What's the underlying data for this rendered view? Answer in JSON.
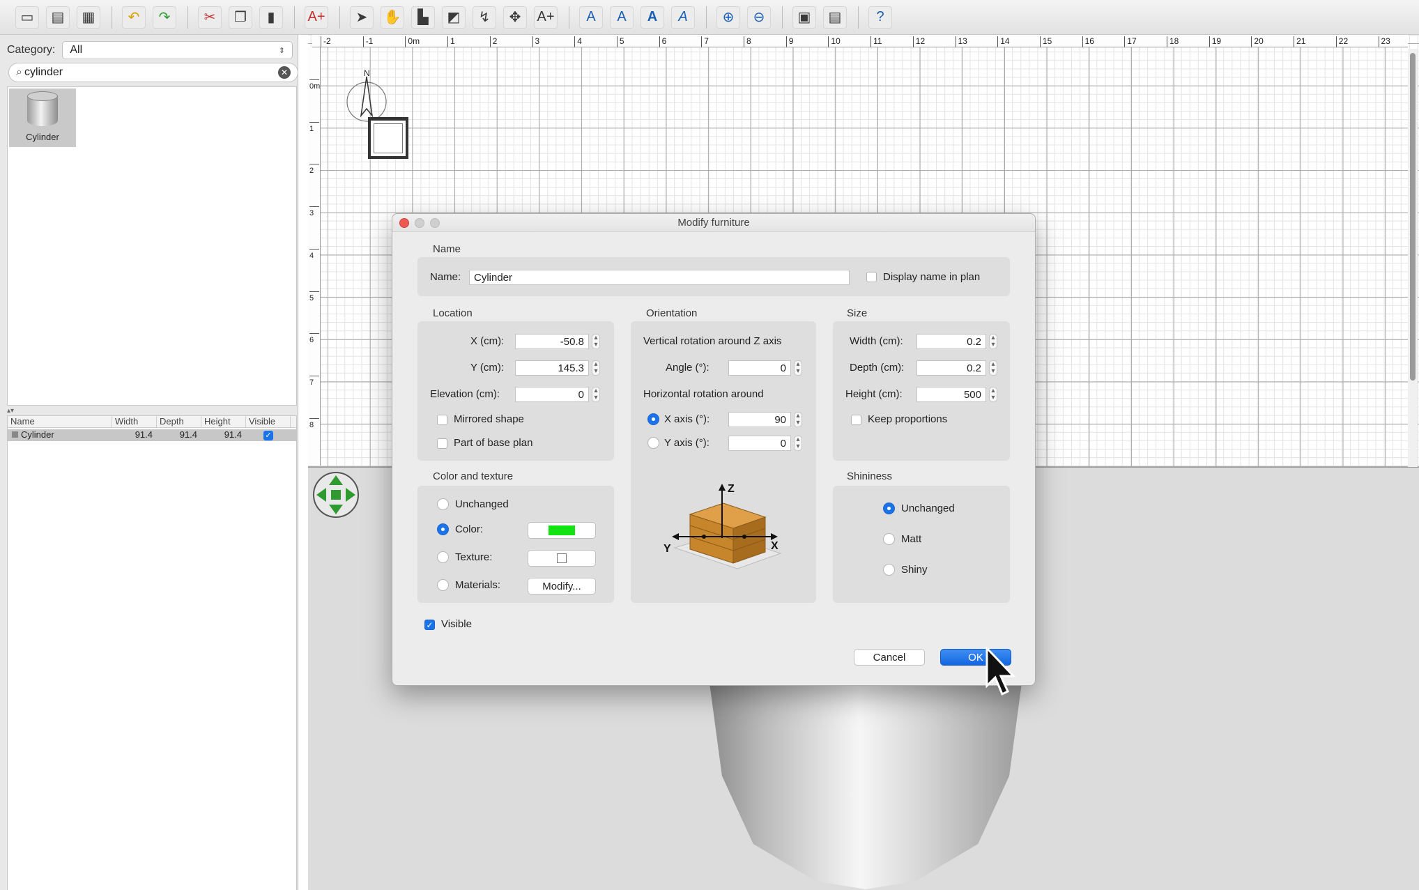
{
  "toolbar": {
    "icons": [
      "new-home-icon",
      "open-icon",
      "save-icon",
      "undo-icon",
      "redo-icon",
      "cut-icon",
      "copy-icon",
      "paste-icon",
      "add-furniture-icon",
      "select-icon",
      "pan-icon",
      "create-walls-icon",
      "create-rooms-icon",
      "create-polylines-icon",
      "create-dimensions-icon",
      "add-text-icon",
      "increase-text-icon",
      "decrease-text-icon",
      "bold-text-icon",
      "italic-text-icon",
      "zoom-in-icon",
      "zoom-out-icon",
      "create-photo-icon",
      "create-video-icon",
      "help-icon"
    ]
  },
  "catalog": {
    "category_label": "Category:",
    "category_value": "All",
    "search_value": "cylinder",
    "item_label": "Cylinder"
  },
  "furniture_table": {
    "headers": [
      "Name",
      "Width",
      "Depth",
      "Height",
      "Visible"
    ],
    "rows": [
      {
        "name": "Cylinder",
        "width": "91.4",
        "depth": "91.4",
        "height": "91.4",
        "visible": true
      }
    ]
  },
  "plan": {
    "ruler_labels": [
      "-2",
      "-1",
      "0m",
      "1",
      "2",
      "3",
      "4",
      "5",
      "6",
      "7",
      "8",
      "9",
      "10",
      "11",
      "12",
      "13",
      "14",
      "15",
      "16",
      "17",
      "18",
      "19",
      "20",
      "21",
      "22",
      "23"
    ],
    "vruler_labels": [
      "0m",
      "1",
      "2",
      "3",
      "4",
      "5",
      "6",
      "7",
      "8"
    ],
    "compass_north": "N"
  },
  "dialog": {
    "title": "Modify furniture",
    "name_section": "Name",
    "name_label": "Name:",
    "name_value": "Cylinder",
    "display_name_label": "Display name in plan",
    "location_section": "Location",
    "x_label": "X (cm):",
    "x_value": "-50.8",
    "y_label": "Y (cm):",
    "y_value": "145.3",
    "elevation_label": "Elevation (cm):",
    "elevation_value": "0",
    "mirrored_label": "Mirrored shape",
    "base_plan_label": "Part of base plan",
    "orientation_section": "Orientation",
    "vertical_rotation_label": "Vertical rotation around Z axis",
    "angle_label": "Angle (°):",
    "angle_value": "0",
    "horizontal_rotation_label": "Horizontal rotation around",
    "x_axis_label": "X axis (°):",
    "x_axis_value": "90",
    "y_axis_label": "Y axis (°):",
    "y_axis_value": "0",
    "axis_z": "Z",
    "axis_x": "X",
    "axis_y": "Y",
    "size_section": "Size",
    "width_label": "Width (cm):",
    "width_value": "0.2",
    "depth_label": "Depth (cm):",
    "depth_value": "0.2",
    "height_label": "Height (cm):",
    "height_value": "500",
    "keep_proportions_label": "Keep proportions",
    "color_section": "Color and texture",
    "unchanged_label": "Unchanged",
    "color_label": "Color:",
    "texture_label": "Texture:",
    "materials_label": "Materials:",
    "modify_button": "Modify...",
    "color_value": "#13e213",
    "shininess_section": "Shininess",
    "shiny_unchanged_label": "Unchanged",
    "matt_label": "Matt",
    "shiny_label": "Shiny",
    "visible_label": "Visible",
    "cancel_button": "Cancel",
    "ok_button": "OK"
  }
}
